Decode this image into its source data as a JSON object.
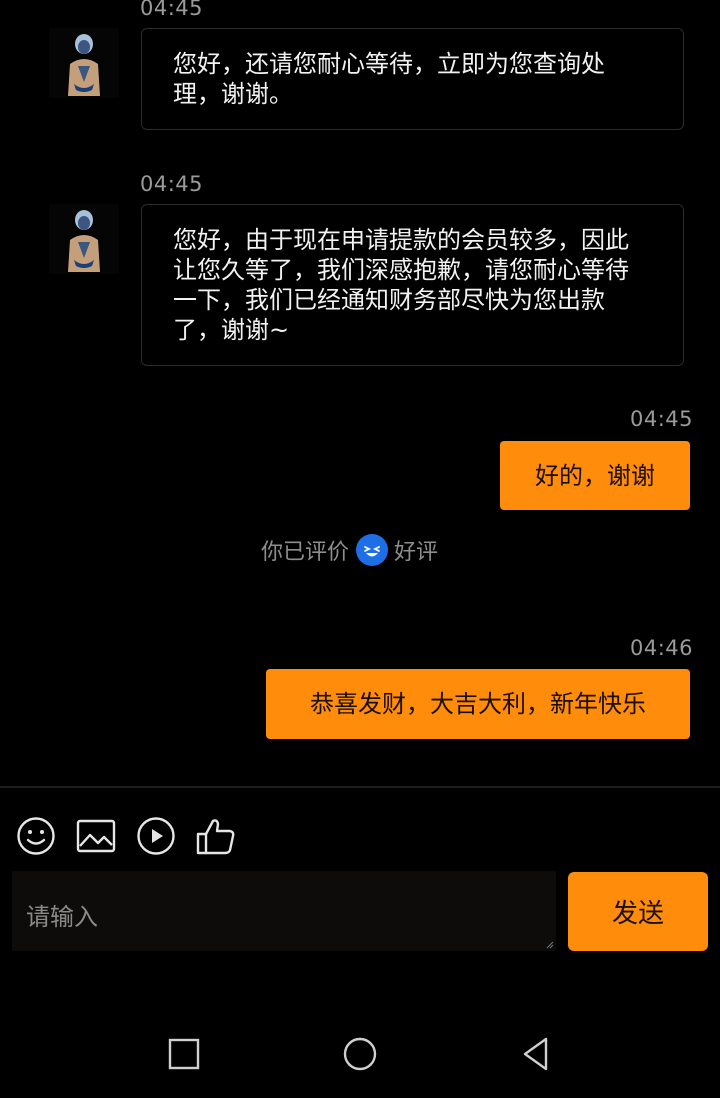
{
  "messages": [
    {
      "time": "04:45",
      "text": "您好，还请您耐心等待，立即为您查询处理，谢谢。"
    },
    {
      "time": "04:45",
      "text": "您好，由于现在申请提款的会员较多，因此让您久等了，我们深感抱歉，请您耐心等待一下，我们已经通知财务部尽快为您出款了，谢谢~"
    },
    {
      "time": "04:45",
      "text": "好的，谢谢"
    },
    {
      "time": "04:46",
      "text": "恭喜发财，大吉大利，新年快乐"
    }
  ],
  "evaluation": {
    "prefix": "你已评价",
    "rating": "好评"
  },
  "composer": {
    "tools": [
      "emoji-icon",
      "image-icon",
      "video-icon",
      "thumbs-up-icon"
    ],
    "placeholder": "请输入",
    "send_label": "发送"
  },
  "colors": {
    "accent": "#ff8c0a",
    "background": "#000000",
    "timestamp": "#9a9a9a"
  },
  "navbar": [
    "recent-apps-icon",
    "home-icon",
    "back-icon"
  ]
}
